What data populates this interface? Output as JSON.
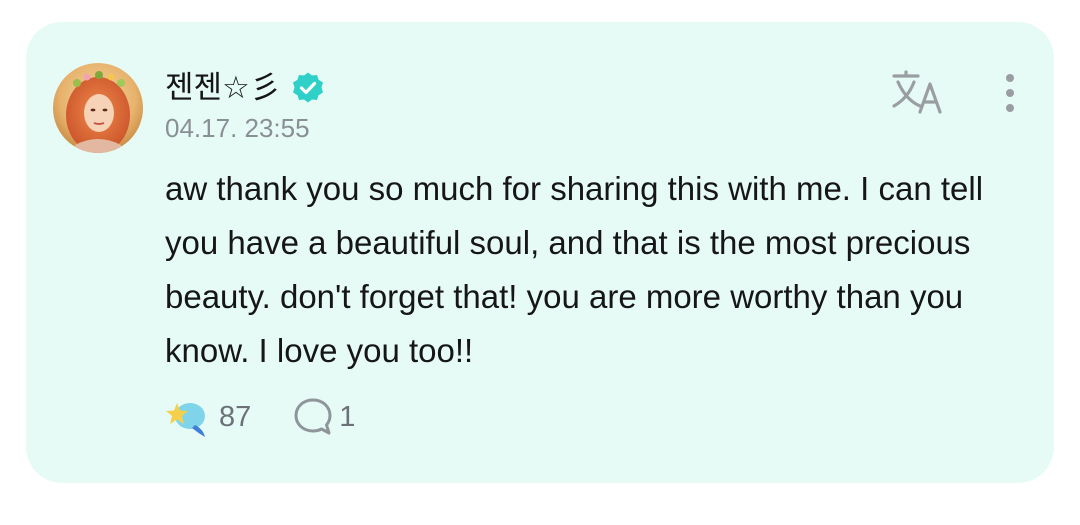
{
  "post": {
    "author": "젠젠☆彡",
    "timestamp": "04.17. 23:55",
    "text": "aw thank you so much for sharing this with me. I can tell you have a beautiful soul, and that is the most precious beauty. don't forget that! you are more worthy than you know. I love you too!!",
    "reaction_count": "87",
    "comment_count": "1"
  },
  "icons": {
    "verified": "verified-check-icon",
    "translate": "translate-icon",
    "more": "more-vertical-icon",
    "reaction": "star-bubble-icon",
    "comment": "speech-bubble-icon"
  },
  "colors": {
    "card_background": "#e6fbf6",
    "verified_badge": "#2fd0c8",
    "text": "#161616",
    "muted_text": "#8a8f95",
    "icon_gray": "#9a9ea3"
  }
}
